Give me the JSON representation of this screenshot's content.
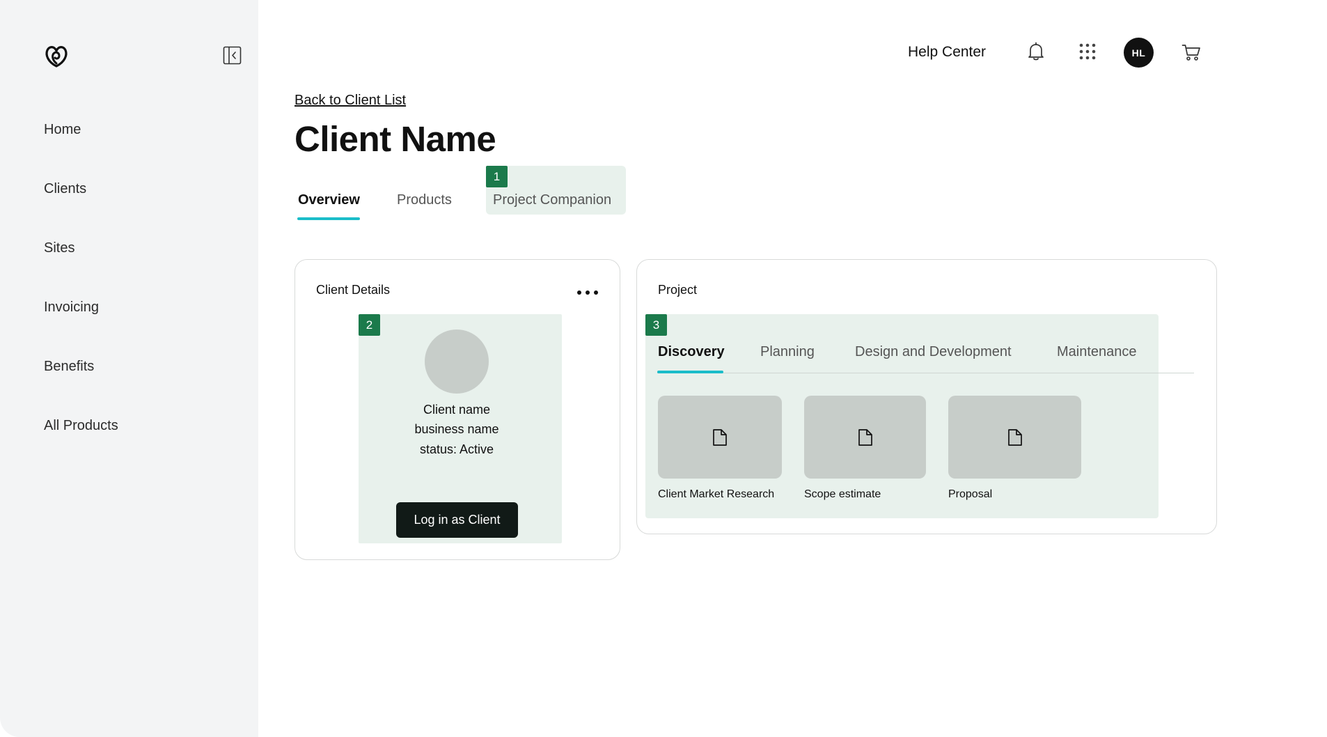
{
  "sidebar": {
    "items": [
      {
        "label": "Home"
      },
      {
        "label": "Clients"
      },
      {
        "label": "Sites"
      },
      {
        "label": "Invoicing"
      },
      {
        "label": "Benefits"
      },
      {
        "label": "All Products"
      }
    ]
  },
  "header": {
    "help_label": "Help Center",
    "avatar_initials": "HL"
  },
  "page": {
    "back_link": "Back to Client List",
    "title": "Client Name",
    "tabs": [
      {
        "label": "Overview",
        "active": true
      },
      {
        "label": "Products",
        "active": false
      },
      {
        "label": "Project Companion",
        "active": false
      }
    ]
  },
  "markers": [
    "1",
    "2",
    "3"
  ],
  "client_card": {
    "title": "Client Details",
    "lines": [
      "Client name",
      "business name",
      "status: Active"
    ],
    "login_label": "Log in as Client"
  },
  "project_card": {
    "title": "Project",
    "tabs": [
      {
        "label": "Discovery",
        "active": true
      },
      {
        "label": "Planning",
        "active": false
      },
      {
        "label": "Design and Development",
        "active": false
      },
      {
        "label": "Maintenance",
        "active": false
      }
    ],
    "documents": [
      {
        "label": "Client Market Research",
        "icon": "document-icon"
      },
      {
        "label": "Scope estimate",
        "icon": "document-icon"
      },
      {
        "label": "Proposal",
        "icon": "document-icon"
      }
    ]
  },
  "colors": {
    "accent": "#1bbdc9",
    "marker": "#1b7a4b",
    "highlight": "#e8f1ec",
    "sidebar_bg": "#f3f4f5"
  }
}
